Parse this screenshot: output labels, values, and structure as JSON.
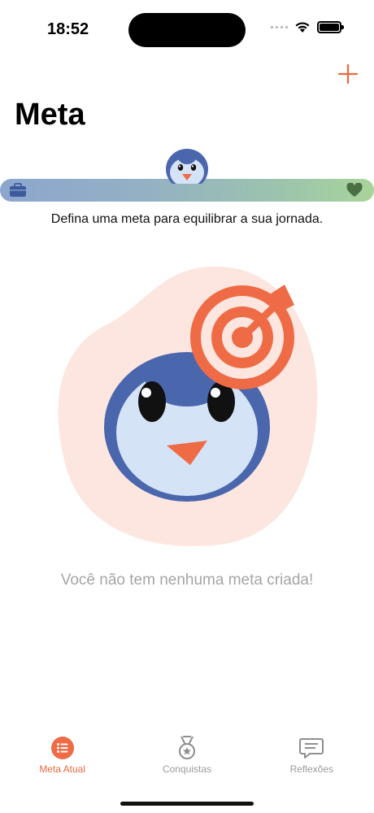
{
  "status_bar": {
    "time": "18:52"
  },
  "header": {
    "title": "Meta",
    "add_icon": "plus-icon"
  },
  "progress": {
    "level": 0.5,
    "left_icon": "briefcase-icon",
    "right_icon": "heart-icon",
    "gradient_start": "#8ca6cf",
    "gradient_end": "#a8d49a"
  },
  "subtitle": "Defina uma meta para equilibrar a sua jornada.",
  "illustration": {
    "subject": "penguin-with-target",
    "blob_color": "#fde6df",
    "penguin_color": "#4a66ad",
    "target_color": "#ee6b45"
  },
  "empty_message": "Você não tem nenhuma meta criada!",
  "tabs": [
    {
      "label": "Meta Atual",
      "icon": "list-icon",
      "active": true
    },
    {
      "label": "Conquistas",
      "icon": "medal-icon",
      "active": false
    },
    {
      "label": "Reflexões",
      "icon": "chat-icon",
      "active": false
    }
  ],
  "colors": {
    "accent": "#e8683f",
    "inactive": "#9a9a9a"
  }
}
